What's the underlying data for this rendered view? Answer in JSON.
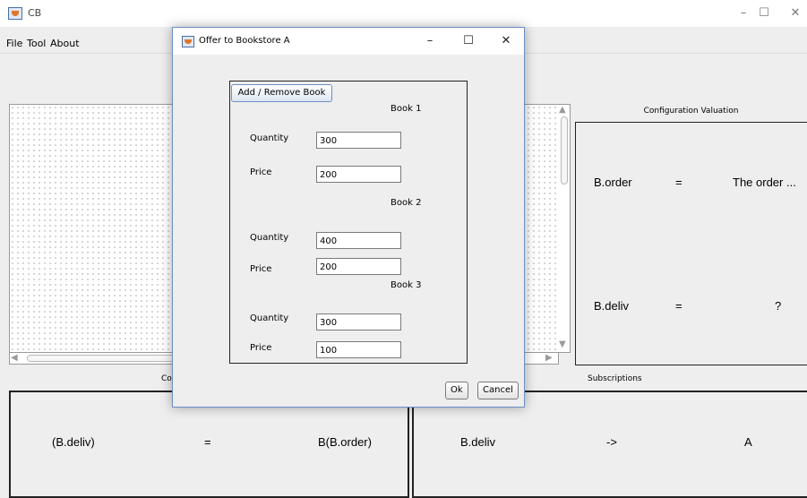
{
  "window": {
    "title": "CB",
    "minimize": "–",
    "maximize": "☐",
    "close": "✕"
  },
  "menu": [
    "File",
    "Tool",
    "About"
  ],
  "canvas": {
    "scroll_up": "▲",
    "scroll_down": "▼",
    "scroll_left": "◀",
    "scroll_right": "▶"
  },
  "config_valuation": {
    "title": "Configuration Valuation",
    "rows": [
      {
        "name": "B.order",
        "op": "=",
        "value": "The order ..."
      },
      {
        "name": "B.deliv",
        "op": "=",
        "value": "?"
      }
    ]
  },
  "left_panel": {
    "title": "Co",
    "row": {
      "name": "(B.deliv)",
      "op": "=",
      "value": "B(B.order)"
    }
  },
  "subscriptions": {
    "title": "Subscriptions",
    "row": {
      "name": "B.deliv",
      "op": "->",
      "value": "A"
    }
  },
  "dialog": {
    "title": "Offer to Bookstore A",
    "minimize": "–",
    "maximize": "☐",
    "close": "✕",
    "add_remove_label": "Add / Remove Book",
    "books": [
      {
        "label": "Book 1",
        "quantity_label": "Quantity",
        "quantity": "300",
        "price_label": "Price",
        "price": "200"
      },
      {
        "label": "Book 2",
        "quantity_label": "Quantity",
        "quantity": "400",
        "price_label": "Price",
        "price": "200"
      },
      {
        "label": "Book 3",
        "quantity_label": "Quantity",
        "quantity": "300",
        "price_label": "Price",
        "price": "100"
      }
    ],
    "ok_label": "Ok",
    "cancel_label": "Cancel"
  }
}
